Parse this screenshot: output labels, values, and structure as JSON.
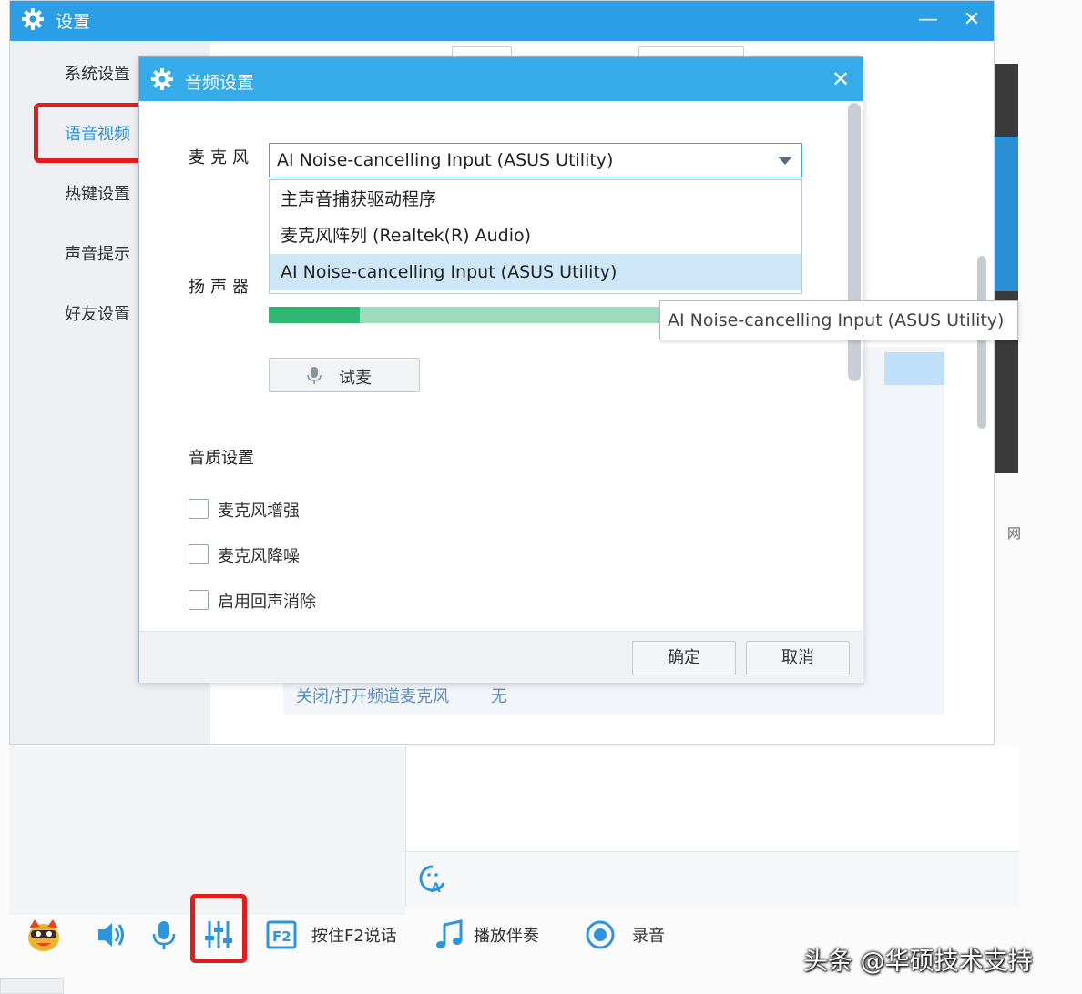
{
  "settings_window": {
    "title": "设置",
    "minimize_glyph": "—",
    "close_glyph": "✕",
    "sidebar": {
      "items": [
        {
          "label": "系统设置"
        },
        {
          "label": "语音视频",
          "selected": true
        },
        {
          "label": "热键设置"
        },
        {
          "label": "声音提示"
        },
        {
          "label": "好友设置"
        }
      ]
    },
    "hotkey_row": {
      "label": "关闭/打开频道麦克风",
      "value": "无"
    }
  },
  "audio_dialog": {
    "title": "音频设置",
    "close_glyph": "✕",
    "microphone": {
      "label": "麦克风",
      "selected_value": "AI Noise-cancelling Input (ASUS Utility)",
      "options": [
        "主声音捕获驱动程序",
        "麦克风阵列 (Realtek(R) Audio)",
        "AI Noise-cancelling Input (ASUS Utility)"
      ],
      "highlighted_option": "AI Noise-cancelling Input (ASUS Utility)"
    },
    "speaker": {
      "label": "扬声器"
    },
    "volume_level": 0.23,
    "test_button_label": "试麦",
    "quality": {
      "heading": "音质设置",
      "options": [
        {
          "label": "麦克风增强",
          "checked": false
        },
        {
          "label": "麦克风降噪",
          "checked": false
        },
        {
          "label": "启用回声消除",
          "checked": false
        }
      ]
    },
    "ok_label": "确定",
    "cancel_label": "取消"
  },
  "tooltip": {
    "text": "AI Noise-cancelling Input (ASUS Utility)"
  },
  "toolbar": {
    "push_to_talk_label": "按住F2说话",
    "push_to_talk_key": "F2",
    "accompaniment_label": "播放伴奏",
    "record_label": "录音"
  },
  "background": {
    "right_edge_text": "网"
  },
  "watermark": "头条 @华硕技术支持",
  "colors": {
    "titlebar_blue": "#2a9ee6",
    "dialog_titlebar_blue": "#35abe9",
    "highlight_red": "#e21c1c",
    "volume_green": "#2fb873",
    "icon_blue": "#2b95e0"
  }
}
